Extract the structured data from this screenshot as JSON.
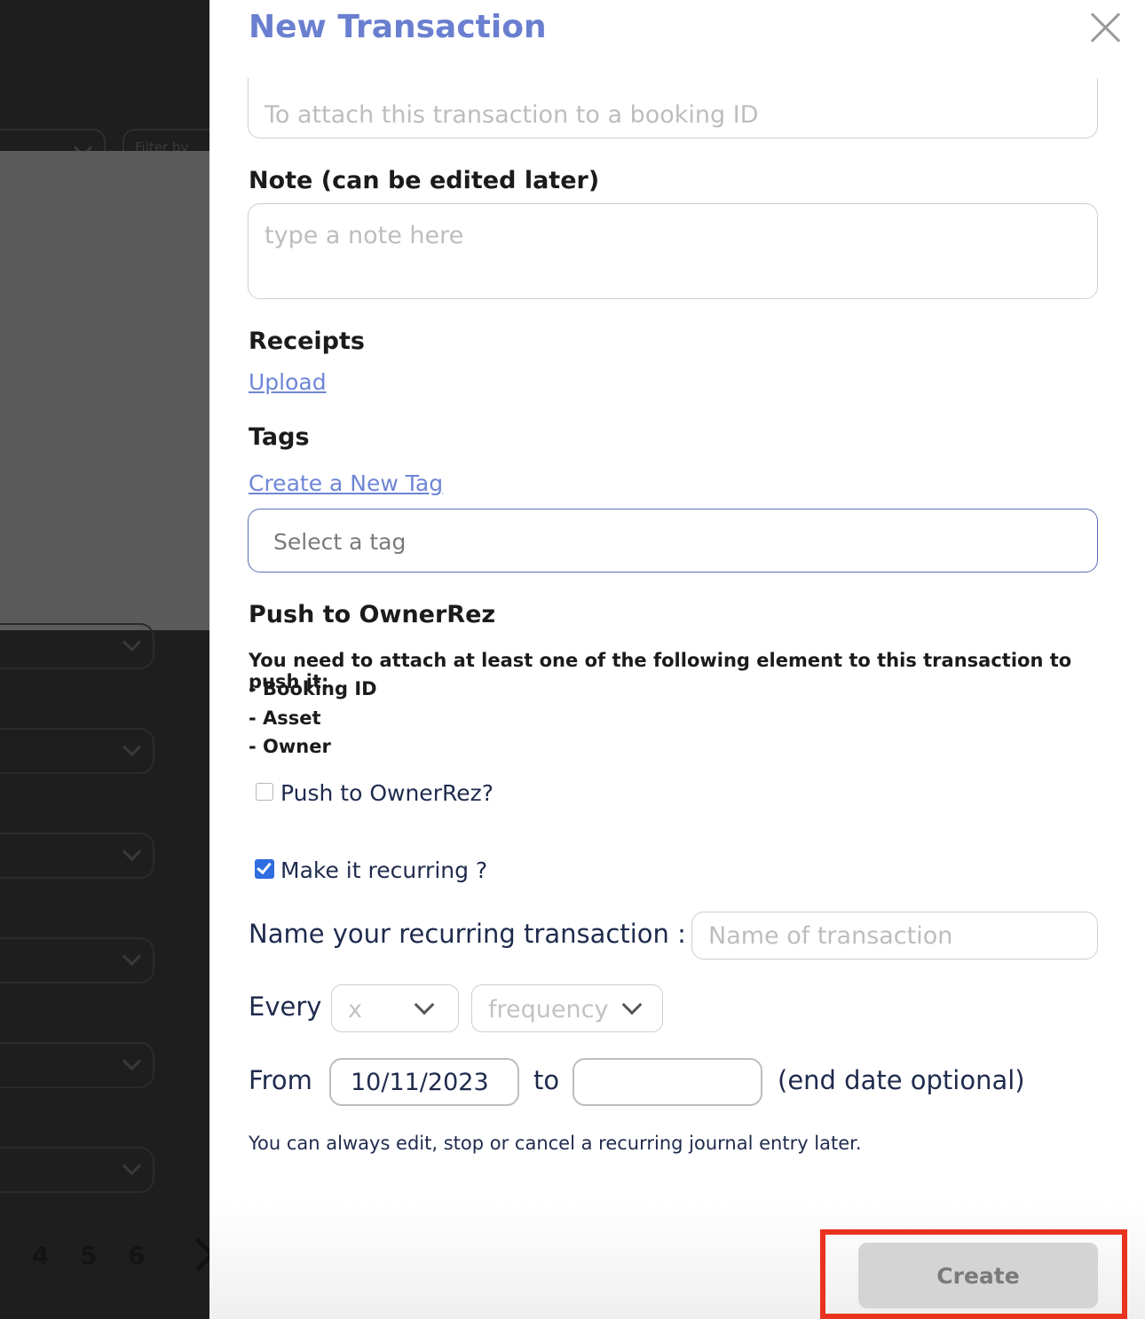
{
  "background": {
    "filter_placeholder": "Filter by",
    "pagination": [
      "4",
      "5",
      "6"
    ]
  },
  "modal": {
    "title": "New Transaction",
    "booking_id_placeholder": "To attach this transaction to a booking ID",
    "note_label": "Note (can be edited later)",
    "note_placeholder": "type a note here",
    "receipts_label": "Receipts",
    "upload_link": "Upload",
    "tags_label": "Tags",
    "create_tag_link": "Create a New Tag",
    "tag_select_placeholder": "Select a tag",
    "push_section_title": "Push to OwnerRez",
    "push_intro": "You need to attach at least one of the following element to this transaction to push it:",
    "push_requirements": [
      "- Booking ID",
      "- Asset",
      "- Owner"
    ],
    "push_checkbox_label": "Push to OwnerRez?",
    "push_checked": false,
    "recurring_checkbox_label": "Make it recurring ?",
    "recurring_checked": true,
    "recurring_name_label": "Name your recurring transaction :",
    "recurring_name_placeholder": "Name of transaction",
    "every_label": "Every",
    "every_count_value": "x",
    "every_frequency_value": "frequency",
    "from_label": "From",
    "from_date": "10/11/2023",
    "to_label": "to",
    "to_date": "",
    "end_date_hint": "(end date optional)",
    "footnote": "You can always edit, stop or cancel a recurring journal entry later.",
    "create_button": "Create"
  },
  "colors": {
    "title": "#6a7fcf",
    "link": "#6f86d6",
    "checkbox_checked": "#2f6de0",
    "highlight": "#e8331e",
    "create_button_bg": "#d4d4d4"
  }
}
